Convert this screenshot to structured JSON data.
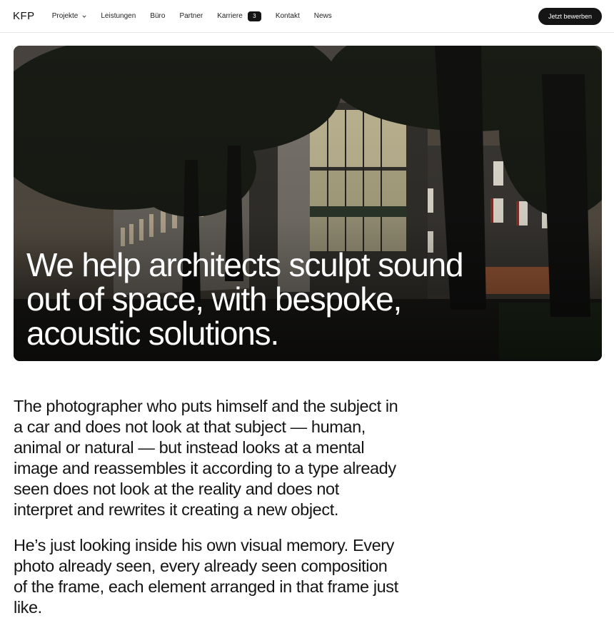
{
  "header": {
    "logo": "KFP",
    "nav": [
      {
        "label": "Projekte",
        "has_dropdown": true
      },
      {
        "label": "Leistungen"
      },
      {
        "label": "Büro"
      },
      {
        "label": "Partner"
      },
      {
        "label": "Karriere",
        "badge": "3"
      },
      {
        "label": "Kontakt"
      },
      {
        "label": "News"
      }
    ],
    "cta_label": "Jetzt bewerben"
  },
  "hero": {
    "title": "We help architects sculpt sound out of space, with bespoke, acoustic solutions.",
    "image_subject": "building-facade-night-photo"
  },
  "content": {
    "paragraph_1": "The photographer who puts himself and the subject in a car and does not look at that subject — human, animal or natural — but instead looks at a mental image and reassembles it according to a type already seen does not look at the reality and does not interpret and rewrites it creating a new object.",
    "paragraph_2": "He’s just looking inside his own visual memory. Every photo already seen, every already seen composition of the frame, each element arranged in that frame just like."
  },
  "colors": {
    "cta_background": "#151515",
    "badge_background": "#151515",
    "text": "#111111"
  }
}
